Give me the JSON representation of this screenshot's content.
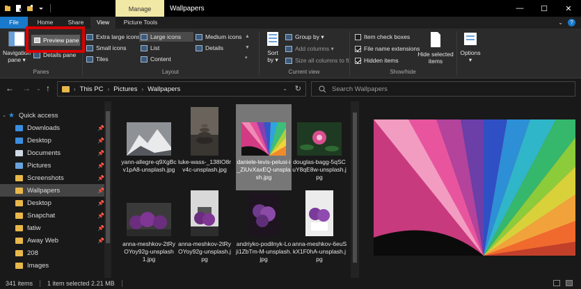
{
  "titlebar": {
    "contextual_tab": "Manage",
    "window_title": "Wallpapers",
    "minimize": "—",
    "maximize": "☐",
    "close": "✕"
  },
  "ribbon_tabs": [
    "File",
    "Home",
    "Share",
    "View",
    "Picture Tools"
  ],
  "active_tab": "View",
  "ribbon": {
    "panes": {
      "navigation_pane": "Navigation\npane ▾",
      "preview_pane": "Preview pane",
      "details_pane": "Details pane",
      "group": "Panes"
    },
    "layout": {
      "items": [
        "Extra large icons",
        "Large icons",
        "Medium icons",
        "Small icons",
        "List",
        "Details",
        "Tiles",
        "Content"
      ],
      "group": "Layout"
    },
    "current_view": {
      "sort_by": "Sort\nby ▾",
      "group_by": "Group by ▾",
      "add_columns": "Add columns ▾",
      "size_columns": "Size all columns to fit",
      "group": "Current view"
    },
    "show_hide": {
      "item_check_boxes": "Item check boxes",
      "file_name_extensions": "File name extensions",
      "hidden_items": "Hidden items",
      "hide_selected": "Hide selected\nitems",
      "group": "Show/hide"
    },
    "options": "Options\n▾"
  },
  "address": {
    "crumbs": [
      "This PC",
      "Pictures",
      "Wallpapers"
    ],
    "search_placeholder": "Search Wallpapers"
  },
  "nav": [
    {
      "label": "Quick access",
      "icon": "star-icon",
      "pinned": false
    },
    {
      "label": "Downloads",
      "icon": "download-icon",
      "pinned": true
    },
    {
      "label": "Desktop",
      "icon": "desktop-icon",
      "pinned": true
    },
    {
      "label": "Documents",
      "icon": "documents-icon",
      "pinned": true
    },
    {
      "label": "Pictures",
      "icon": "pictures-icon",
      "pinned": true
    },
    {
      "label": "Screenshots",
      "icon": "folder-icon",
      "pinned": true
    },
    {
      "label": "Wallpapers",
      "icon": "folder-icon",
      "pinned": true,
      "selected": true
    },
    {
      "label": "Desktop",
      "icon": "folder-icon",
      "pinned": true
    },
    {
      "label": "Snapchat",
      "icon": "folder-icon",
      "pinned": true
    },
    {
      "label": "fatiw",
      "icon": "folder-icon",
      "pinned": true
    },
    {
      "label": "Away Web",
      "icon": "folder-icon",
      "pinned": true
    },
    {
      "label": "208",
      "icon": "folder-icon",
      "pinned": false
    },
    {
      "label": "Images",
      "icon": "folder-icon",
      "pinned": false
    }
  ],
  "files": [
    {
      "name": "yann-allegre-q9XgBcv1pA8-unsplash.jpg",
      "thumb": "snowy-mountain"
    },
    {
      "name": "luke-wass-_138IO8rv4c-unsplash.jpg",
      "thumb": "stacked-stones"
    },
    {
      "name": "daniele-levis-pelusi-i_ZiUvXaxEQ-unsplash.jpg",
      "thumb": "rainbow-rays",
      "selected": true
    },
    {
      "name": "douglas-bagg-5qSCuY8qE8w-unsplash.jpg",
      "thumb": "pink-flower"
    },
    {
      "name": "anna-meshkov-2tRyOYoy92g-unsplash 1.jpg",
      "thumb": "purple-flowers"
    },
    {
      "name": "anna-meshkov-2tRyOYoy92g-unsplash.jpg",
      "thumb": "purple-flowers-pot"
    },
    {
      "name": "andriyko-podilnyk-Loji1ZbTm-M-unsplash.jpg",
      "thumb": "lilac-cluster"
    },
    {
      "name": "anna-meshkov-6euSkX1F0hA-unsplash.jpg",
      "thumb": "purple-flowers-white"
    }
  ],
  "status": {
    "count": "341 items",
    "selection": "1 item selected  2.21 MB"
  },
  "colors": {
    "accent": "#1979ca",
    "highlight": "#d90000",
    "manage_tab": "#f2e8a6"
  }
}
